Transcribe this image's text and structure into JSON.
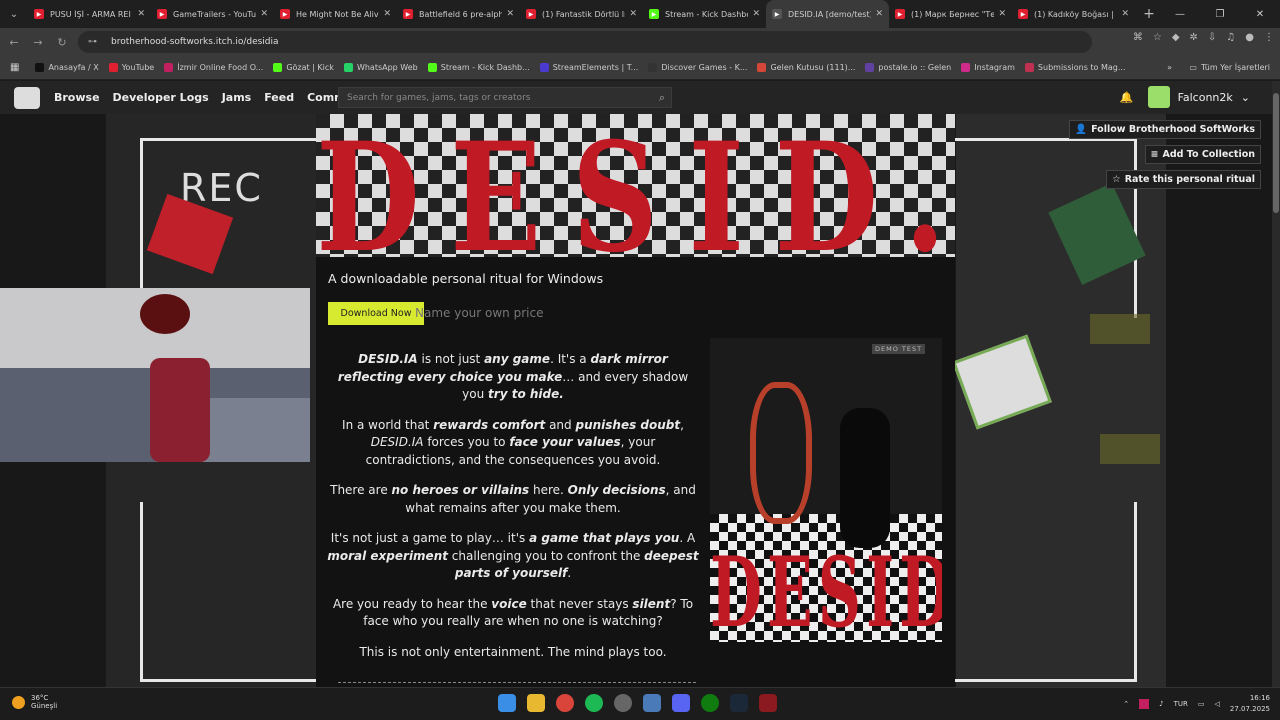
{
  "browser": {
    "tabs": [
      {
        "title": "PUSU İŞİ - ARMA REI",
        "color": "#e02030"
      },
      {
        "title": "GameTrailers - YouTu",
        "color": "#e02030"
      },
      {
        "title": "He Might Not Be Aliv",
        "color": "#e02030"
      },
      {
        "title": "Battlefield 6 pre-alph",
        "color": "#e02030"
      },
      {
        "title": "(1) Fantastik Dörtlü In",
        "color": "#e02030"
      },
      {
        "title": "Stream - Kick Dashbo",
        "color": "#53fc18"
      },
      {
        "title": "DESID.IA [demo/test]",
        "color": "#555555",
        "active": true
      },
      {
        "title": "(1) Марк Бернес \"Те",
        "color": "#e02030"
      },
      {
        "title": "(1) Kadıköy Boğası |",
        "color": "#e02030"
      }
    ],
    "url": "brotherhood-softworks.itch.io/desidia",
    "bookmarks": [
      {
        "label": "Anasayfa / X",
        "color": "#111111"
      },
      {
        "label": "YouTube",
        "color": "#e02030"
      },
      {
        "label": "İzmir Online Food O...",
        "color": "#c02060"
      },
      {
        "label": "Gözat | Kick",
        "color": "#53fc18"
      },
      {
        "label": "WhatsApp Web",
        "color": "#25d366"
      },
      {
        "label": "Stream - Kick Dashb...",
        "color": "#53fc18"
      },
      {
        "label": "StreamElements | T...",
        "color": "#4a3ad0"
      },
      {
        "label": "Discover Games - K...",
        "color": "#333333"
      },
      {
        "label": "Gelen Kutusu (111)...",
        "color": "#d44638"
      },
      {
        "label": "postale.io :: Gelen",
        "color": "#6040a0"
      },
      {
        "label": "Instagram",
        "color": "#d02a8a"
      },
      {
        "label": "Submissions to Mag...",
        "color": "#c03050"
      }
    ],
    "all_bookmarks": "Tüm Yer İşaretleri"
  },
  "itch": {
    "nav": [
      "Browse",
      "Developer Logs",
      "Jams",
      "Feed",
      "Community"
    ],
    "search_placeholder": "Search for games, jams, tags or creators",
    "username": "Falconn2k"
  },
  "game": {
    "banner_title": "DESID.IA",
    "tagline": "A downloadable personal ritual for Windows",
    "download_label": "Download Now",
    "price_label": "Name your own price",
    "cover_badge": "DEMO TEST",
    "follow_label": "Follow Brotherhood SoftWorks",
    "collection_label": "Add To Collection",
    "rate_label": "Rate this personal ritual",
    "rec_label": "REC",
    "paragraphs": [
      "DESID.IA is not just any game. It's a dark mirror reflecting every choice you make… and every shadow you try to hide.",
      "In a world that rewards comfort and punishes doubt, DESID.IA forces you to face your values, your contradictions, and the consequences you avoid.",
      "There are no heroes or villains here. Only decisions, and what remains after you make them.",
      "It's not just a game to play… it's a game that plays you. A moral experiment challenging you to confront the deepest parts of yourself.",
      "Are you ready to hear the voice that never stays silent? To face who you really are when no one is watching?",
      "This is not only entertainment. The mind plays too."
    ]
  },
  "taskbar": {
    "temp": "36°C",
    "weather": "Güneşli",
    "lang": "TUR",
    "time": "16:16",
    "date": "27.07.2025"
  }
}
